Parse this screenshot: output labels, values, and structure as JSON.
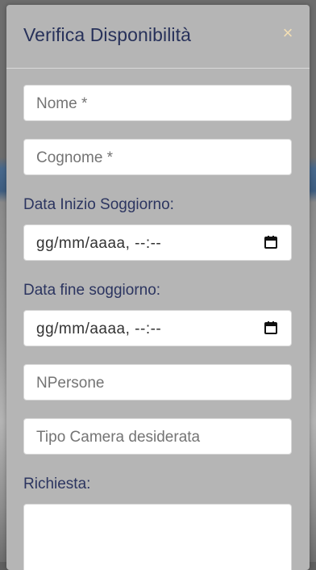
{
  "modal": {
    "title": "Verifica Disponibilità",
    "close_glyph": "×"
  },
  "form": {
    "nome_placeholder": "Nome *",
    "cognome_placeholder": "Cognome *",
    "data_inizio_label": "Data Inizio Soggiorno:",
    "data_inizio_value": "gg/mm/aaaa, --:--",
    "data_fine_label": "Data fine soggiorno:",
    "data_fine_value": "gg/mm/aaaa, --:--",
    "npersone_placeholder": "NPersone",
    "tipo_camera_placeholder": "Tipo Camera desiderata",
    "richiesta_label": "Richiesta:"
  },
  "colors": {
    "title": "#27315a",
    "close": "#f3dfb4",
    "modal_bg": "#b5b5b5"
  },
  "icons": {
    "close": "close-icon",
    "calendar": "calendar-icon"
  }
}
